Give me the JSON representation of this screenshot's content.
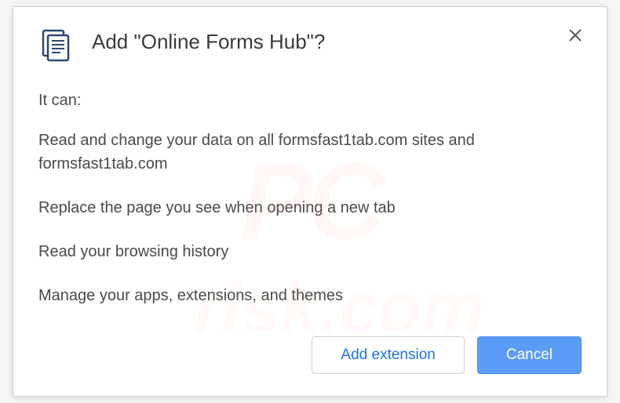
{
  "dialog": {
    "title": "Add \"Online Forms Hub\"?",
    "it_can_label": "It can:",
    "permissions": [
      "Read and change your data on all formsfast1tab.com sites and formsfast1tab.com",
      "Replace the page you see when opening a new tab",
      "Read your browsing history",
      "Manage your apps, extensions, and themes"
    ],
    "buttons": {
      "add": "Add extension",
      "cancel": "Cancel"
    }
  },
  "watermark": {
    "line1": "PC",
    "line2": "risk.com"
  }
}
